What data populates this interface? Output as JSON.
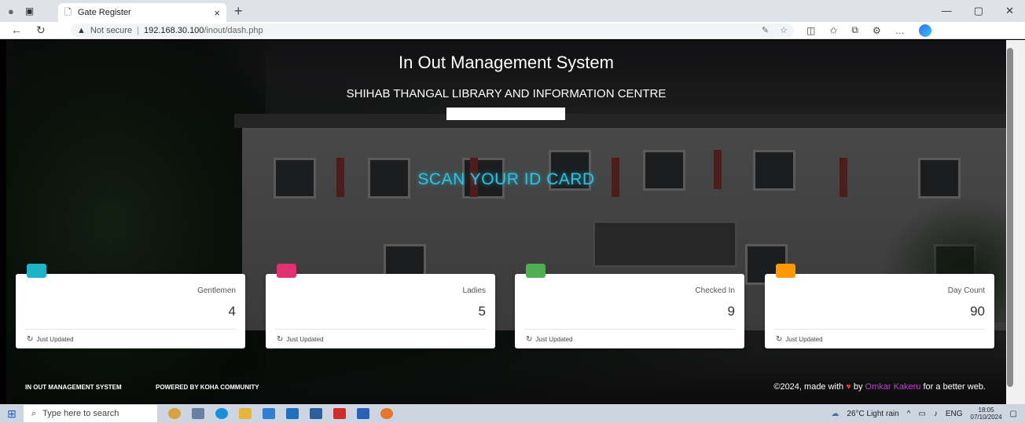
{
  "browser": {
    "tab_title": "Gate Register",
    "tab_close": "×",
    "new_tab": "+",
    "security_label": "Not secure",
    "url_host": "192.168.30.100",
    "url_path": "/inout/dash.php",
    "window_controls": [
      "—",
      "▢",
      "✕"
    ]
  },
  "page": {
    "title": "In Out Management System",
    "subtitle": "SHIHAB THANGAL LIBRARY AND INFORMATION CENTRE",
    "scan_prompt": "SCAN YOUR ID CARD",
    "scan_input_value": ""
  },
  "cards": [
    {
      "label": "Gentlemen",
      "value": "4",
      "footer": "Just Updated",
      "color": "#1fb3c8"
    },
    {
      "label": "Ladies",
      "value": "5",
      "footer": "Just Updated",
      "color": "#e0306f"
    },
    {
      "label": "Checked In",
      "value": "9",
      "footer": "Just Updated",
      "color": "#4caf50"
    },
    {
      "label": "Day Count",
      "value": "90",
      "footer": "Just Updated",
      "color": "#ff9800"
    }
  ],
  "footer": {
    "link1": "IN OUT MANAGEMENT SYSTEM",
    "link2": "POWERED BY KOHA COMMUNITY",
    "copy_prefix": "©2024, made with",
    "copy_by": "by",
    "author": "Omkar Kakeru",
    "copy_suffix": "for a better web."
  },
  "taskbar": {
    "search_placeholder": "Type here to search",
    "weather": "26°C  Light rain",
    "lang": "ENG",
    "time": "18:05",
    "date": "07/10/2024"
  }
}
